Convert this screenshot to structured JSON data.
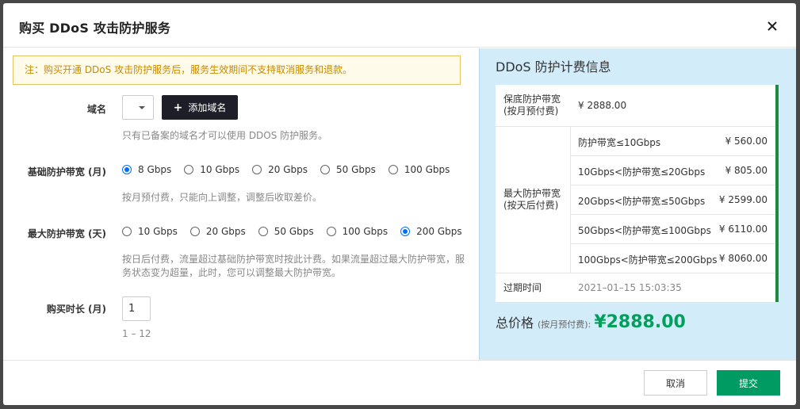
{
  "dialog": {
    "title": "购买 DDoS 攻击防护服务"
  },
  "form": {
    "notice": "注：购买开通 DDoS 攻击防护服务后，服务生效期间不支持取消服务和退款。",
    "domain": {
      "label": "域名",
      "add_button": "添加域名",
      "hint": "只有已备案的域名才可以使用 DDOS 防护服务。"
    },
    "base_bandwidth": {
      "label": "基础防护带宽 (月)",
      "options": [
        "8 Gbps",
        "10 Gbps",
        "20 Gbps",
        "50 Gbps",
        "100 Gbps"
      ],
      "selected": "8 Gbps",
      "hint": "按月预付费，只能向上调整，调整后收取差价。"
    },
    "max_bandwidth": {
      "label": "最大防护带宽 (天)",
      "options": [
        "10 Gbps",
        "20 Gbps",
        "50 Gbps",
        "100 Gbps",
        "200 Gbps"
      ],
      "selected": "200 Gbps",
      "hint_line1": "按日后付费，流量超过基础防护带宽时按此计费。如果流量超过最大防护带宽，服",
      "hint_line2": "务状态变为超量，此时，您可以调整最大防护带宽。"
    },
    "duration": {
      "label": "购买时长 (月)",
      "value": "1",
      "hint": "1 – 12"
    }
  },
  "billing": {
    "title": "DDoS 防护计费信息",
    "base": {
      "label_line1": "保底防护带宽",
      "label_line2": "(按月预付费)",
      "price": "¥ 2888.00"
    },
    "max": {
      "label_line1": "最大防护带宽",
      "label_line2": "(按天后付费)",
      "tiers": [
        {
          "range": "防护带宽≤10Gbps",
          "price": "¥ 560.00"
        },
        {
          "range": "10Gbps<防护带宽≤20Gbps",
          "price": "¥ 805.00"
        },
        {
          "range": "20Gbps<防护带宽≤50Gbps",
          "price": "¥ 2599.00"
        },
        {
          "range": "50Gbps<防护带宽≤100Gbps",
          "price": "¥ 6110.00"
        },
        {
          "range": "100Gbps<防护带宽≤200Gbps",
          "price": "¥ 8060.00"
        }
      ]
    },
    "expire": {
      "label": "过期时间",
      "value": "2021–01–15 15:03:35"
    },
    "total": {
      "label": "总价格",
      "note": "(按月预付费):",
      "price": "¥2888.00"
    }
  },
  "footer": {
    "cancel": "取消",
    "submit": "提交"
  },
  "colors": {
    "accent_green": "#00a05a",
    "submit_green": "#009a63",
    "radio_blue": "#006eff",
    "notice_border": "#e8c266"
  }
}
